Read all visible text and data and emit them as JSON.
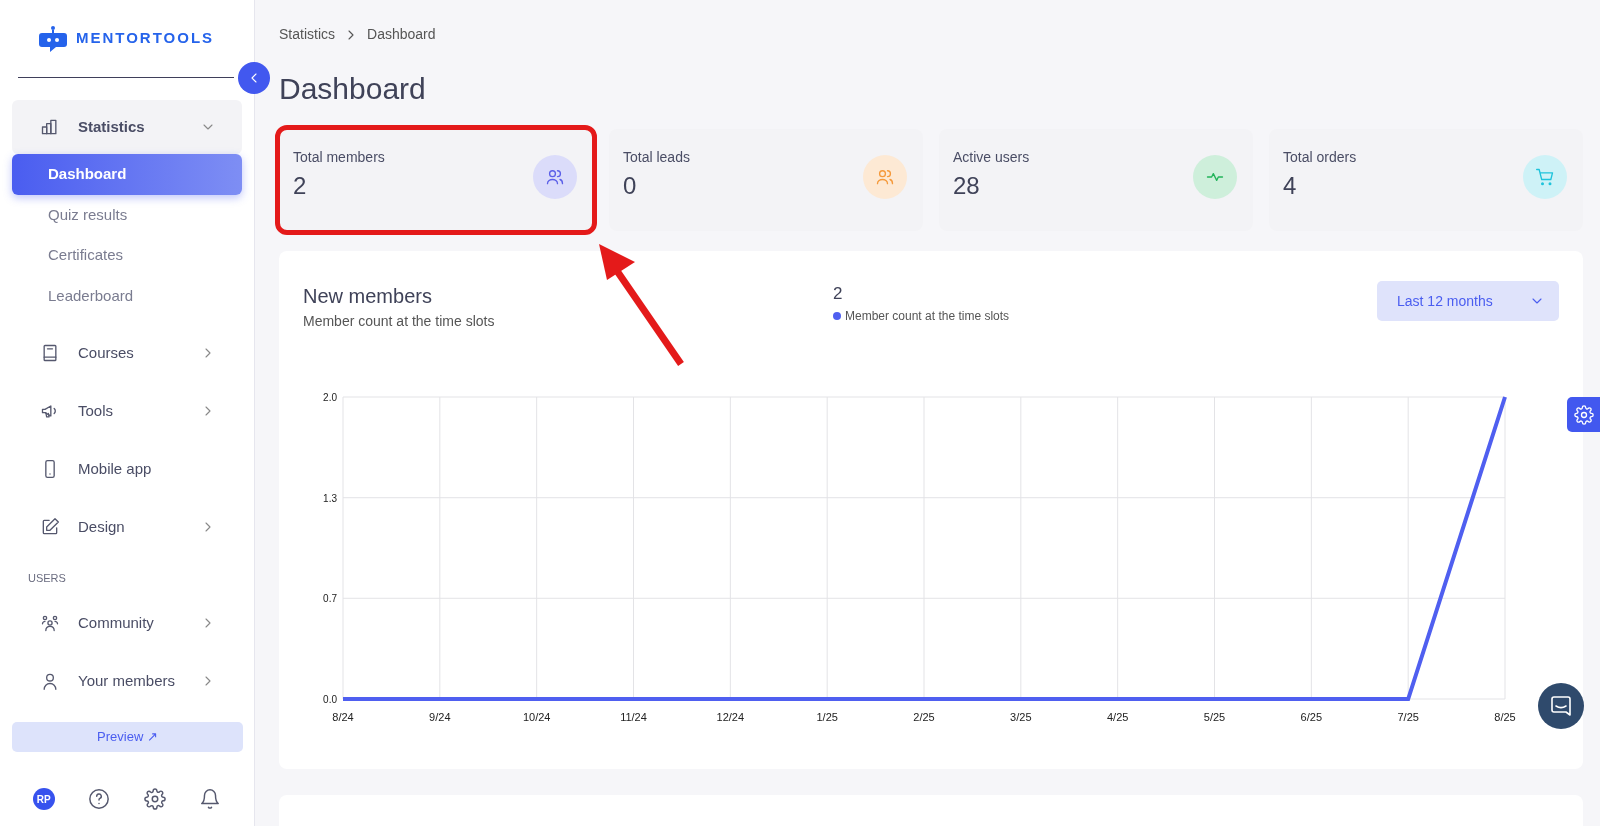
{
  "brand": {
    "name": "MENTORTOOLS"
  },
  "sidebar": {
    "items": [
      {
        "kind": "group",
        "label": "Statistics",
        "expanded": true,
        "children": [
          {
            "label": "Dashboard",
            "selected": true
          },
          {
            "label": "Quiz results",
            "selected": false
          },
          {
            "label": "Certificates",
            "selected": false
          },
          {
            "label": "Leaderboard",
            "selected": false
          }
        ]
      },
      {
        "kind": "group",
        "label": "Courses",
        "expanded": false
      },
      {
        "kind": "group",
        "label": "Tools",
        "expanded": false
      },
      {
        "kind": "link",
        "label": "Mobile app"
      },
      {
        "kind": "group",
        "label": "Design",
        "expanded": false
      },
      {
        "kind": "heading",
        "label": "USERS"
      },
      {
        "kind": "group",
        "label": "Community",
        "expanded": false
      },
      {
        "kind": "group",
        "label": "Your members",
        "expanded": false
      }
    ],
    "preview_button": "Preview ↗",
    "avatar": "RP"
  },
  "breadcrumb": [
    "Statistics",
    "Dashboard"
  ],
  "page_title": "Dashboard",
  "stats": [
    {
      "label": "Total members",
      "value": "2",
      "color": "#5b5fe8",
      "highlighted": true
    },
    {
      "label": "Total leads",
      "value": "0",
      "color": "#f5993a",
      "highlighted": false
    },
    {
      "label": "Active users",
      "value": "28",
      "color": "#22b45a",
      "highlighted": false
    },
    {
      "label": "Total orders",
      "value": "4",
      "color": "#1ec3db",
      "highlighted": false
    }
  ],
  "new_members": {
    "title": "New members",
    "subtitle": "Member count at the time slots",
    "total": "2",
    "range_select": "Last 12 months",
    "chart_data": {
      "type": "line",
      "categories": [
        "8/24",
        "9/24",
        "10/24",
        "11/24",
        "12/24",
        "1/25",
        "2/25",
        "3/25",
        "4/25",
        "5/25",
        "6/25",
        "7/25",
        "8/25"
      ],
      "series": [
        {
          "name": "Member count at the time slots",
          "color": "#4f5ff0",
          "values": [
            0,
            0,
            0,
            0,
            0,
            0,
            0,
            0,
            0,
            0,
            0,
            0,
            2
          ]
        }
      ],
      "ylim": [
        0,
        2
      ],
      "grid": true,
      "yticks": [
        {
          "value": 0,
          "label": "0.0"
        },
        {
          "value": 0.667,
          "label": "0.7"
        },
        {
          "value": 1.333,
          "label": "1.3"
        },
        {
          "value": 2,
          "label": "2.0"
        }
      ]
    }
  }
}
